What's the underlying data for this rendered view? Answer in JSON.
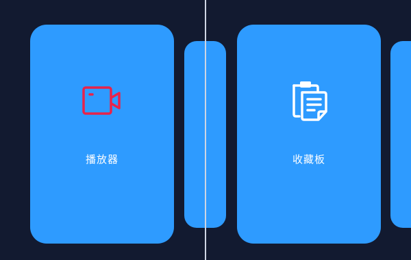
{
  "cards": [
    {
      "label": "播放器",
      "icon": "video-camera-icon",
      "icon_color": "#e8234a"
    },
    {
      "label": "收藏板",
      "icon": "clipboard-icon",
      "icon_color": "#ffffff"
    }
  ],
  "colors": {
    "background": "#121a30",
    "card": "#2e9bff",
    "divider": "#cfd6e4"
  }
}
